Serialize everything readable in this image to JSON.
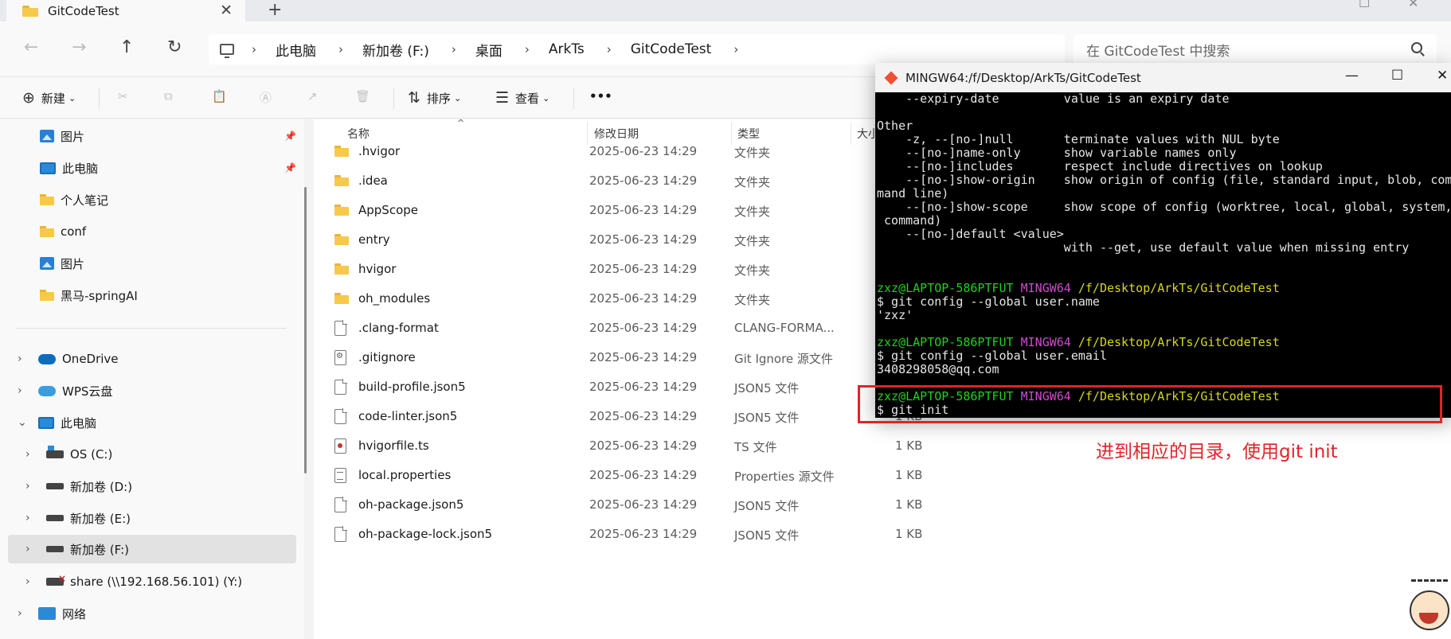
{
  "tab": {
    "title": "GitCodeTest",
    "close": "✕",
    "add": "+"
  },
  "nav": {
    "back": "←",
    "forward": "→",
    "up": "↑",
    "refresh": "↻"
  },
  "address": {
    "sep": "›",
    "crumbs": [
      "此电脑",
      "新加卷 (F:)",
      "桌面",
      "ArkTs",
      "GitCodeTest"
    ]
  },
  "search": {
    "placeholder": "在 GitCodeTest 中搜索"
  },
  "commandbar": {
    "new": "新建",
    "sort": "排序",
    "view": "查看",
    "more": "•••",
    "new_glyph": "⊕",
    "sort_glyph": "⇅",
    "view_glyph": "☰",
    "cut_glyph": "✂",
    "copy_glyph": "⧉",
    "paste_glyph": "📋",
    "rename_glyph": "Ⓐ",
    "share_glyph": "↗",
    "delete_glyph": "🗑",
    "caret": "⌄"
  },
  "sidebar": {
    "items": [
      {
        "label": "图片",
        "icon": "picture-icon",
        "pinned": true
      },
      {
        "label": "此电脑",
        "icon": "pc-icon",
        "pinned": true
      },
      {
        "label": "个人笔记",
        "icon": "folder-icon"
      },
      {
        "label": "conf",
        "icon": "folder-icon"
      },
      {
        "label": "图片",
        "icon": "picture-icon"
      },
      {
        "label": "黑马-springAI",
        "icon": "folder-icon"
      },
      {
        "label": "OneDrive",
        "icon": "onedrive-icon"
      },
      {
        "label": "WPS云盘",
        "icon": "wps-cloud-icon"
      },
      {
        "label": "此电脑",
        "icon": "pc-icon"
      },
      {
        "label": "OS (C:)",
        "icon": "os-drive-icon"
      },
      {
        "label": "新加卷 (D:)",
        "icon": "drive-icon"
      },
      {
        "label": "新加卷 (E:)",
        "icon": "drive-icon"
      },
      {
        "label": "新加卷 (F:)",
        "icon": "drive-icon",
        "selected": true
      },
      {
        "label": "share (\\\\192.168.56.101) (Y:)",
        "icon": "network-drive-icon"
      },
      {
        "label": "网络",
        "icon": "network-icon"
      }
    ],
    "pin_glyph": "📌",
    "chev_right": "›",
    "chev_down": "⌄"
  },
  "columns": {
    "name": "名称",
    "date": "修改日期",
    "type": "类型",
    "size": "大小"
  },
  "files": [
    {
      "name": ".hvigor",
      "date": "2025-06-23 14:29",
      "type": "文件夹",
      "size": "",
      "kind": "folder"
    },
    {
      "name": ".idea",
      "date": "2025-06-23 14:29",
      "type": "文件夹",
      "size": "",
      "kind": "folder"
    },
    {
      "name": "AppScope",
      "date": "2025-06-23 14:29",
      "type": "文件夹",
      "size": "",
      "kind": "folder"
    },
    {
      "name": "entry",
      "date": "2025-06-23 14:29",
      "type": "文件夹",
      "size": "",
      "kind": "folder"
    },
    {
      "name": "hvigor",
      "date": "2025-06-23 14:29",
      "type": "文件夹",
      "size": "",
      "kind": "folder"
    },
    {
      "name": "oh_modules",
      "date": "2025-06-23 14:29",
      "type": "文件夹",
      "size": "",
      "kind": "folder"
    },
    {
      "name": ".clang-format",
      "date": "2025-06-23 14:29",
      "type": "CLANG-FORMA...",
      "size": "",
      "kind": "file"
    },
    {
      "name": ".gitignore",
      "date": "2025-06-23 14:29",
      "type": "Git Ignore 源文件",
      "size": "",
      "kind": "gear"
    },
    {
      "name": "build-profile.json5",
      "date": "2025-06-23 14:29",
      "type": "JSON5 文件",
      "size": "",
      "kind": "file"
    },
    {
      "name": "code-linter.json5",
      "date": "2025-06-23 14:29",
      "type": "JSON5 文件",
      "size": "1 KB",
      "kind": "file"
    },
    {
      "name": "hvigorfile.ts",
      "date": "2025-06-23 14:29",
      "type": "TS 文件",
      "size": "1 KB",
      "kind": "ts"
    },
    {
      "name": "local.properties",
      "date": "2025-06-23 14:29",
      "type": "Properties 源文件",
      "size": "1 KB",
      "kind": "props"
    },
    {
      "name": "oh-package.json5",
      "date": "2025-06-23 14:29",
      "type": "JSON5 文件",
      "size": "1 KB",
      "kind": "file"
    },
    {
      "name": "oh-package-lock.json5",
      "date": "2025-06-23 14:29",
      "type": "JSON5 文件",
      "size": "1 KB",
      "kind": "file"
    }
  ],
  "terminal": {
    "title": "MINGW64:/f/Desktop/ArkTs/GitCodeTest",
    "minimize": "—",
    "maximize": "☐",
    "close": "✕",
    "lines": [
      [
        {
          "t": "    --expiry-date         value is an expiry date"
        }
      ],
      [
        {
          "t": ""
        }
      ],
      [
        {
          "t": "Other"
        }
      ],
      [
        {
          "t": "    -z, --[no-]null       terminate values with NUL byte"
        }
      ],
      [
        {
          "t": "    --[no-]name-only      show variable names only"
        }
      ],
      [
        {
          "t": "    --[no-]includes       respect include directives on lookup"
        }
      ],
      [
        {
          "t": "    --[no-]show-origin    show origin of config (file, standard input, blob, com"
        }
      ],
      [
        {
          "t": "mand line)"
        }
      ],
      [
        {
          "t": "    --[no-]show-scope     show scope of config (worktree, local, global, system,"
        }
      ],
      [
        {
          "t": " command)"
        }
      ],
      [
        {
          "t": "    --[no-]default <value>"
        }
      ],
      [
        {
          "t": "                          with --get, use default value when missing entry"
        }
      ],
      [
        {
          "t": ""
        }
      ],
      [
        {
          "t": ""
        }
      ],
      [
        {
          "t": "zxz@LAPTOP-586PTFUT ",
          "c": "green"
        },
        {
          "t": "MINGW64 ",
          "c": "mag"
        },
        {
          "t": "/f/Desktop/ArkTs/GitCodeTest",
          "c": "yel"
        }
      ],
      [
        {
          "t": "$ git config --global user.name"
        }
      ],
      [
        {
          "t": "'zxz'"
        }
      ],
      [
        {
          "t": ""
        }
      ],
      [
        {
          "t": "zxz@LAPTOP-586PTFUT ",
          "c": "green"
        },
        {
          "t": "MINGW64 ",
          "c": "mag"
        },
        {
          "t": "/f/Desktop/ArkTs/GitCodeTest",
          "c": "yel"
        }
      ],
      [
        {
          "t": "$ git config --global user.email"
        }
      ],
      [
        {
          "t": "3408298058@qq.com"
        }
      ],
      [
        {
          "t": ""
        }
      ],
      [
        {
          "t": "zxz@LAPTOP-586PTFUT ",
          "c": "green"
        },
        {
          "t": "MINGW64 ",
          "c": "mag"
        },
        {
          "t": "/f/Desktop/ArkTs/GitCodeTest",
          "c": "yel"
        }
      ],
      [
        {
          "t": "$ git init"
        }
      ]
    ]
  },
  "annotation": "进到相应的目录，使用git init",
  "colors": {
    "annotation": "#e0242a",
    "folder": "#f6c94a",
    "selected": "#e2e2e2"
  }
}
